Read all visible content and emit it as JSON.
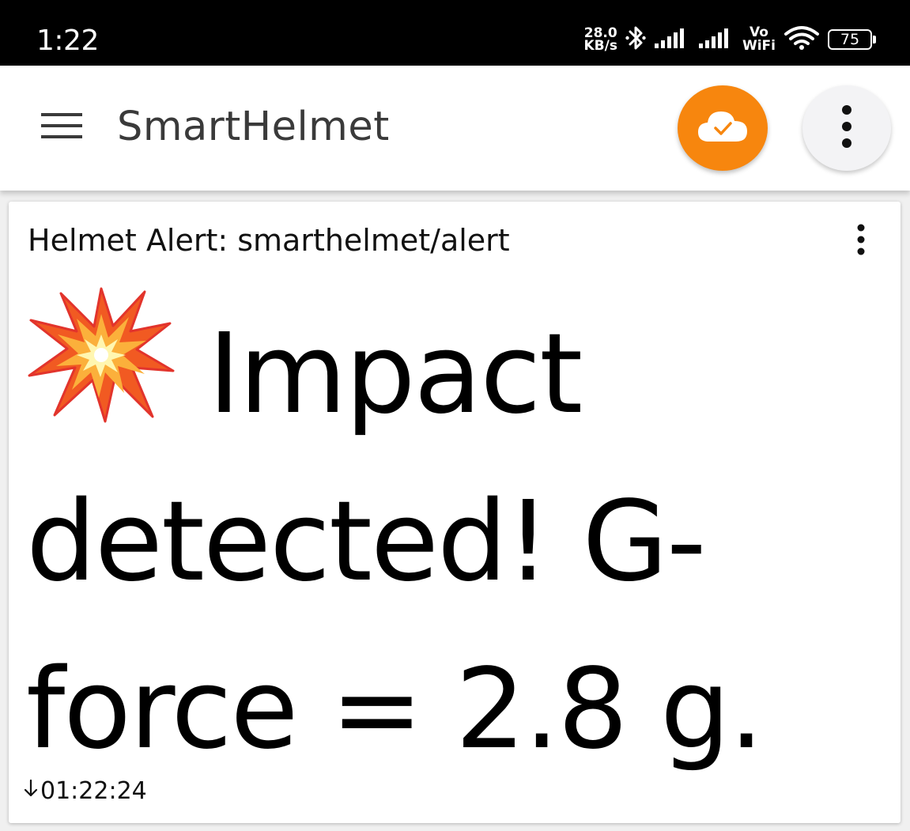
{
  "status_bar": {
    "time": "1:22",
    "net_speed_value": "28.0",
    "net_speed_unit": "KB/s",
    "vowifi_top": "Vo",
    "vowifi_bottom": "WiFi",
    "battery_level": "75",
    "icons": [
      "bluetooth-icon",
      "signal-icon",
      "signal-icon",
      "wifi-icon",
      "battery-icon"
    ]
  },
  "app_bar": {
    "title": "SmartHelmet",
    "icons": [
      "menu-icon",
      "cloud-check-icon",
      "more-vert-icon"
    ]
  },
  "card": {
    "header": "Helmet Alert: smarthelmet/alert",
    "emoji_icon": "collision-icon",
    "message": "Impact detected! G-force = 2.8 g.",
    "timestamp": "01:22:24",
    "timestamp_icon": "arrow-down-icon"
  },
  "colors": {
    "accent": "#f7860e",
    "status_bar_bg": "#000000",
    "app_bar_bg": "#ffffff",
    "page_bg": "#f0f0f0"
  }
}
